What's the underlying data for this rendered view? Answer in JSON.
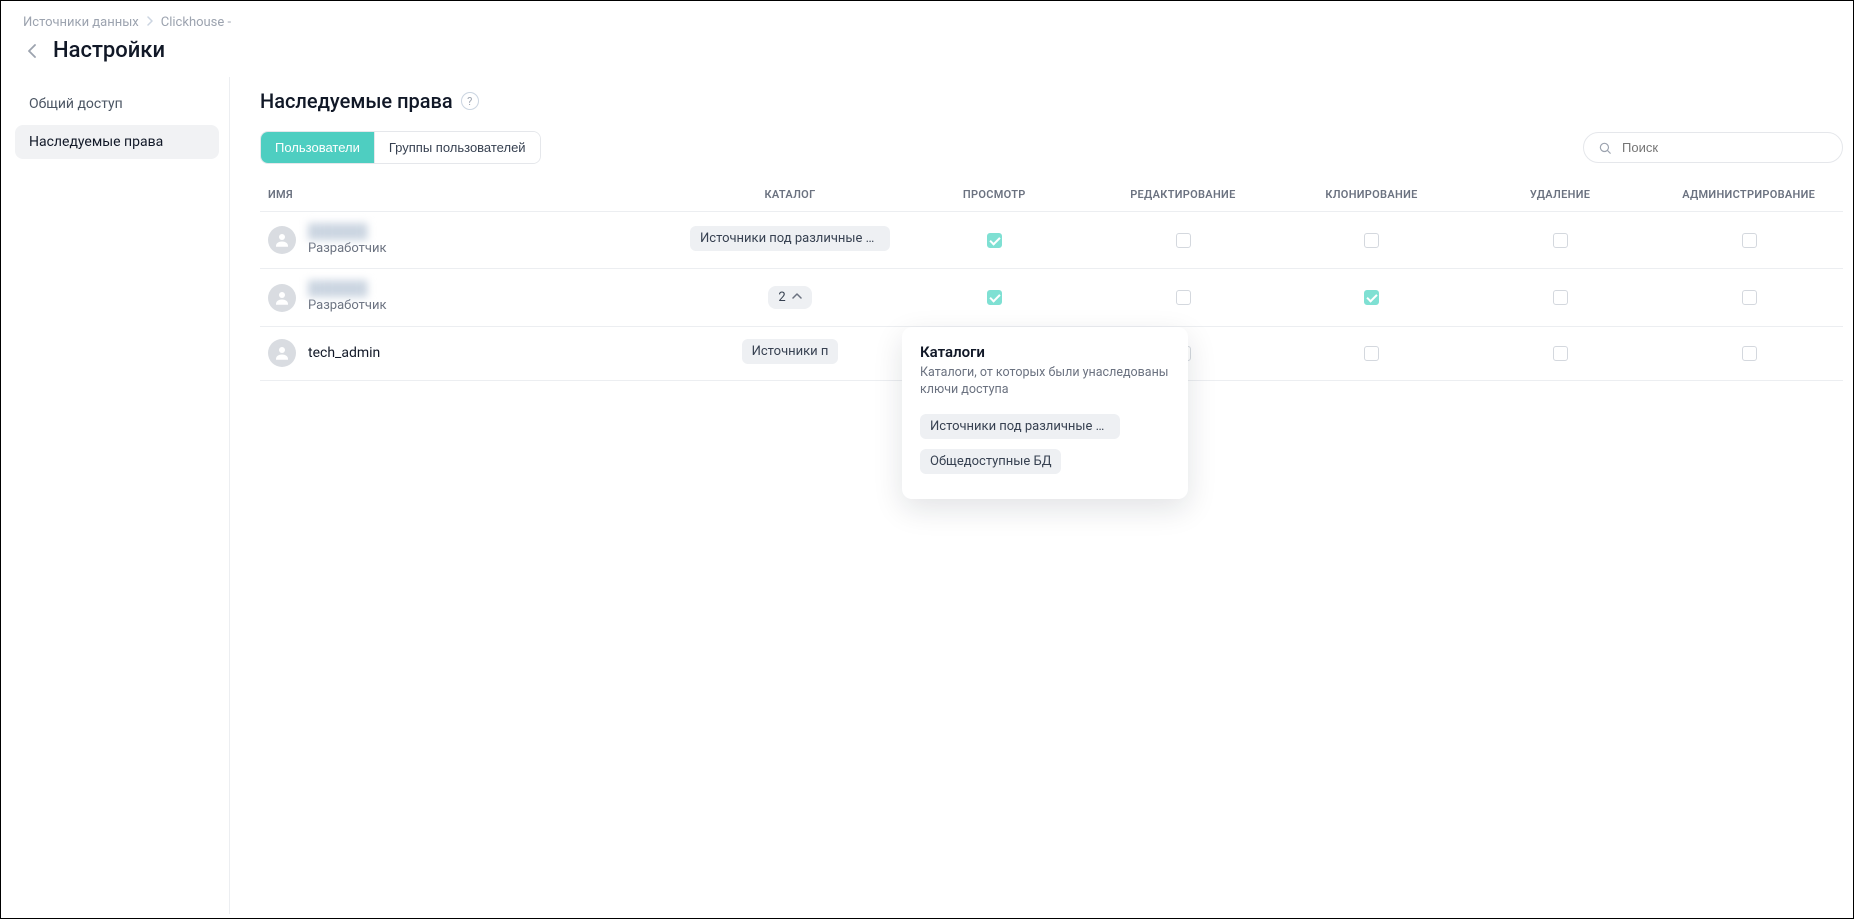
{
  "breadcrumb": {
    "root": "Источники данных",
    "current": "Clickhouse -"
  },
  "page_title": "Настройки",
  "sidebar": {
    "items": [
      {
        "label": "Общий доступ"
      },
      {
        "label": "Наследуемые права"
      }
    ]
  },
  "section": {
    "title": "Наследуемые права"
  },
  "tabs": {
    "users": "Пользователи",
    "groups": "Группы пользователей"
  },
  "search": {
    "placeholder": "Поиск"
  },
  "columns": {
    "name": "Имя",
    "catalog": "Каталог",
    "view": "Просмотр",
    "edit": "Редактирование",
    "clone": "Клонирование",
    "delete": "Удаление",
    "admin": "Администрирование"
  },
  "rows": [
    {
      "name": "",
      "name_blurred": true,
      "role": "Разработчик",
      "catalog_label": "Источники под различные С...",
      "catalog_count": null,
      "view": true,
      "edit": false,
      "clone": false,
      "del": false,
      "admin": false
    },
    {
      "name": "",
      "name_blurred": true,
      "role": "Разработчик",
      "catalog_label": null,
      "catalog_count": "2",
      "view": true,
      "edit": false,
      "clone": true,
      "del": false,
      "admin": false
    },
    {
      "name": "tech_admin",
      "name_blurred": false,
      "role": "",
      "catalog_label": "Источники п",
      "catalog_count": null,
      "view": false,
      "edit": false,
      "clone": false,
      "del": false,
      "admin": false
    }
  ],
  "popover": {
    "title": "Каталоги",
    "desc": "Каталоги, от которых были унаследованы ключи доступа",
    "items": [
      "Источники под различные СУБД",
      "Общедоступные БД"
    ]
  }
}
